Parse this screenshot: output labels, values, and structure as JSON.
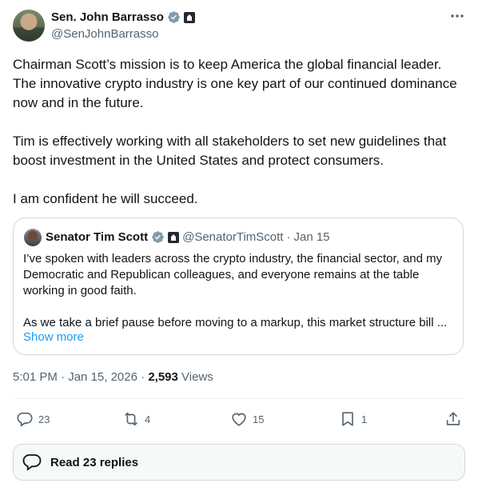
{
  "author": {
    "name": "Sen. John Barrasso",
    "handle": "@SenJohnBarrasso"
  },
  "tweet": {
    "paragraphs": [
      "Chairman Scott’s mission is to keep America the global financial leader. The innovative crypto industry is one key part of our continued dominance now and in the future.",
      "Tim is effectively working with all stakeholders to set new guidelines that boost investment in the United States and protect consumers.",
      "I am confident he will succeed."
    ]
  },
  "quote": {
    "name": "Senator Tim Scott",
    "handle": "@SenatorTimScott",
    "separator": "·",
    "date": "Jan 15",
    "paragraph1": "I’ve spoken with leaders across the crypto industry, the financial sector, and my Democratic and Republican colleagues, and everyone remains at the table working in good faith.",
    "paragraph2": "As we take a brief pause before moving to a markup, this market structure bill ...",
    "show_more": "Show more"
  },
  "meta": {
    "time": "5:01 PM",
    "date": "Jan 15, 2026",
    "separator": "·",
    "views_count": "2,593",
    "views_label": "Views"
  },
  "actions": {
    "replies": "23",
    "reposts": "4",
    "likes": "15",
    "bookmarks": "1"
  },
  "read_replies": "Read 23 replies",
  "colors": {
    "accent": "#1d9bf0",
    "text": "#0f1419",
    "secondary": "#536471",
    "border": "#cfd9de"
  }
}
